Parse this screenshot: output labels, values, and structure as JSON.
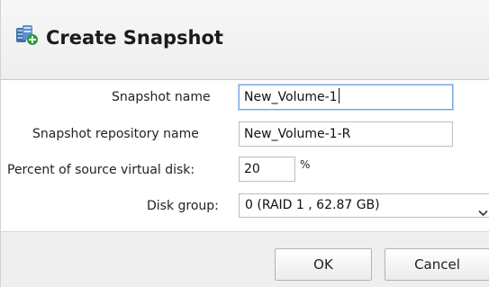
{
  "dialog": {
    "title": "Create Snapshot",
    "title_icon": "snapshot-create-icon"
  },
  "form": {
    "snapshot_name": {
      "label": "Snapshot name",
      "value": "New_Volume-1"
    },
    "repository_name": {
      "label": "Snapshot repository name",
      "value": "New_Volume-1-R"
    },
    "percent": {
      "label": "Percent of source virtual disk:",
      "value": "20",
      "unit": "%"
    },
    "disk_group": {
      "label": "Disk group:",
      "selected": "0 (RAID 1 , 62.87 GB)",
      "icon": "chevron-down-icon"
    }
  },
  "buttons": {
    "ok_label": "OK",
    "cancel_label": "Cancel"
  },
  "colors": {
    "focus_border": "#7aa7e6",
    "header_bg": "#eeeeee",
    "footer_bg": "#efefef"
  }
}
